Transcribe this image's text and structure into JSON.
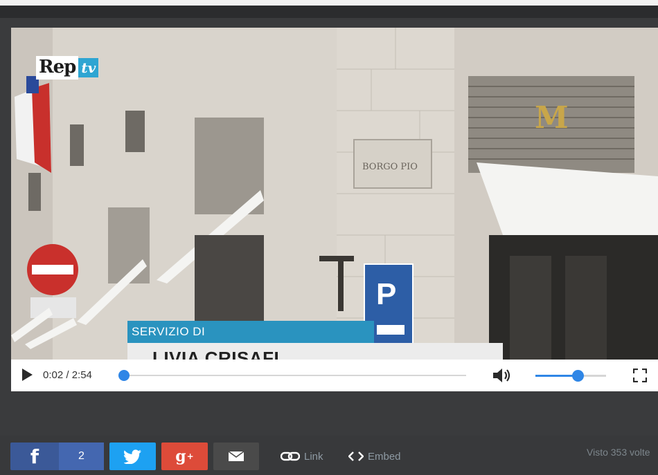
{
  "player": {
    "logo": {
      "brand": "Rep",
      "suffix": "tv"
    },
    "lower_third": {
      "label": "SERVIZIO DI",
      "name": "LIVIA CRISAFI"
    },
    "controls": {
      "time": "0:02 / 2:54",
      "progress_fraction": 0.011,
      "volume_fraction": 0.6,
      "play_icon": "play-icon",
      "volume_icon": "volume-icon",
      "fullscreen_icon": "fullscreen-icon"
    },
    "scene_signs": {
      "street_sign": "BORGO PIO",
      "parking_sign": "P"
    }
  },
  "share_bar": {
    "facebook": {
      "icon": "f",
      "count": "2",
      "color": "#3b5998"
    },
    "twitter": {
      "icon": "twitter-bird-icon",
      "color": "#1da1f2"
    },
    "google_plus": {
      "icon": "g",
      "color": "#dd4b39"
    },
    "email": {
      "icon": "mail-icon",
      "color": "#4a4a4a"
    },
    "link_label": "Link",
    "embed_label": "Embed",
    "views_text": "Visto 353 volte"
  },
  "colors": {
    "accent": "#2f86e6",
    "frame": "#3a3b3d"
  }
}
